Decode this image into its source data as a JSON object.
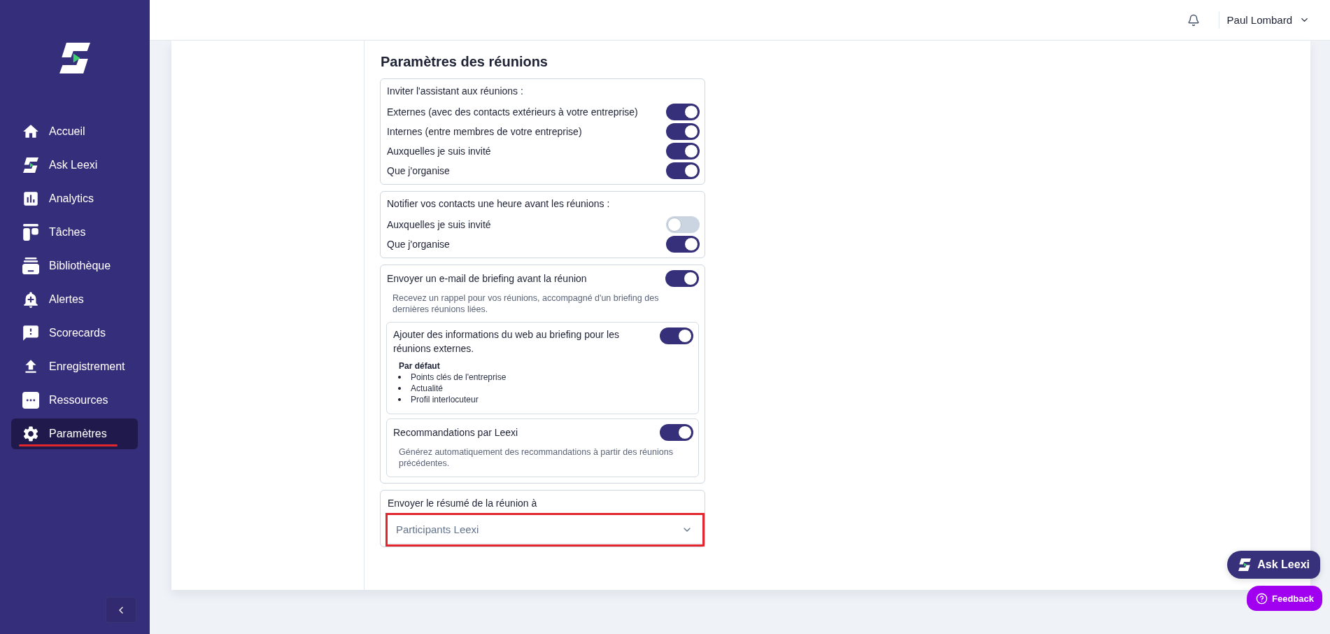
{
  "sidebar": {
    "items": [
      {
        "label": "Accueil",
        "selected": false,
        "underlined": false
      },
      {
        "label": "Ask Leexi",
        "selected": false,
        "underlined": false
      },
      {
        "label": "Analytics",
        "selected": false,
        "underlined": false
      },
      {
        "label": "Tâches",
        "selected": false,
        "underlined": false
      },
      {
        "label": "Bibliothèque",
        "selected": false,
        "underlined": false
      },
      {
        "label": "Alertes",
        "selected": false,
        "underlined": false
      },
      {
        "label": "Scorecards",
        "selected": false,
        "underlined": false
      },
      {
        "label": "Enregistrement",
        "selected": false,
        "underlined": false
      },
      {
        "label": "Ressources",
        "selected": false,
        "underlined": false
      },
      {
        "label": "Paramètres",
        "selected": true,
        "underlined": true
      }
    ]
  },
  "topbar": {
    "user_name": "Paul Lombard"
  },
  "page": {
    "title": "Paramètres des réunions",
    "sections": [
      {
        "kind": "toggle_group",
        "label": "Inviter l'assistant aux réunions :",
        "options": [
          {
            "label": "Externes (avec des contacts extérieurs à votre entreprise)",
            "on": true
          },
          {
            "label": "Internes (entre membres de votre entreprise)",
            "on": true
          },
          {
            "label": "Auxquelles je suis invité",
            "on": true
          },
          {
            "label": "Que j'organise",
            "on": true
          }
        ]
      },
      {
        "kind": "toggle_group",
        "label": "Notifier vos contacts une heure avant les réunions :",
        "options": [
          {
            "label": "Auxquelles je suis invité",
            "on": false
          },
          {
            "label": "Que j'organise",
            "on": true
          }
        ]
      },
      {
        "kind": "briefing",
        "label": "Envoyer un e-mail de briefing avant la réunion",
        "on": true,
        "description": "Recevez un rappel pour vos réunions, accompagné d'un briefing des dernières réunions liées.",
        "subsections": [
          {
            "label": "Ajouter des informations du web au briefing pour les réunions externes.",
            "on": true,
            "defaults_title": "Par défaut",
            "defaults": [
              "Points clés de l'entreprise",
              "Actualité",
              "Profil interlocuteur"
            ]
          },
          {
            "label": "Recommandations par Leexi",
            "on": true,
            "description": "Générez automatiquement des recommandations à partir des réunions précédentes."
          }
        ]
      },
      {
        "kind": "select",
        "label": "Envoyer le résumé de la réunion à",
        "value": "Participants Leexi",
        "highlighted": true
      }
    ]
  },
  "floating_buttons": [
    {
      "kind": "ask",
      "label": "Ask Leexi"
    },
    {
      "kind": "feedback",
      "label": "Feedback"
    }
  ]
}
